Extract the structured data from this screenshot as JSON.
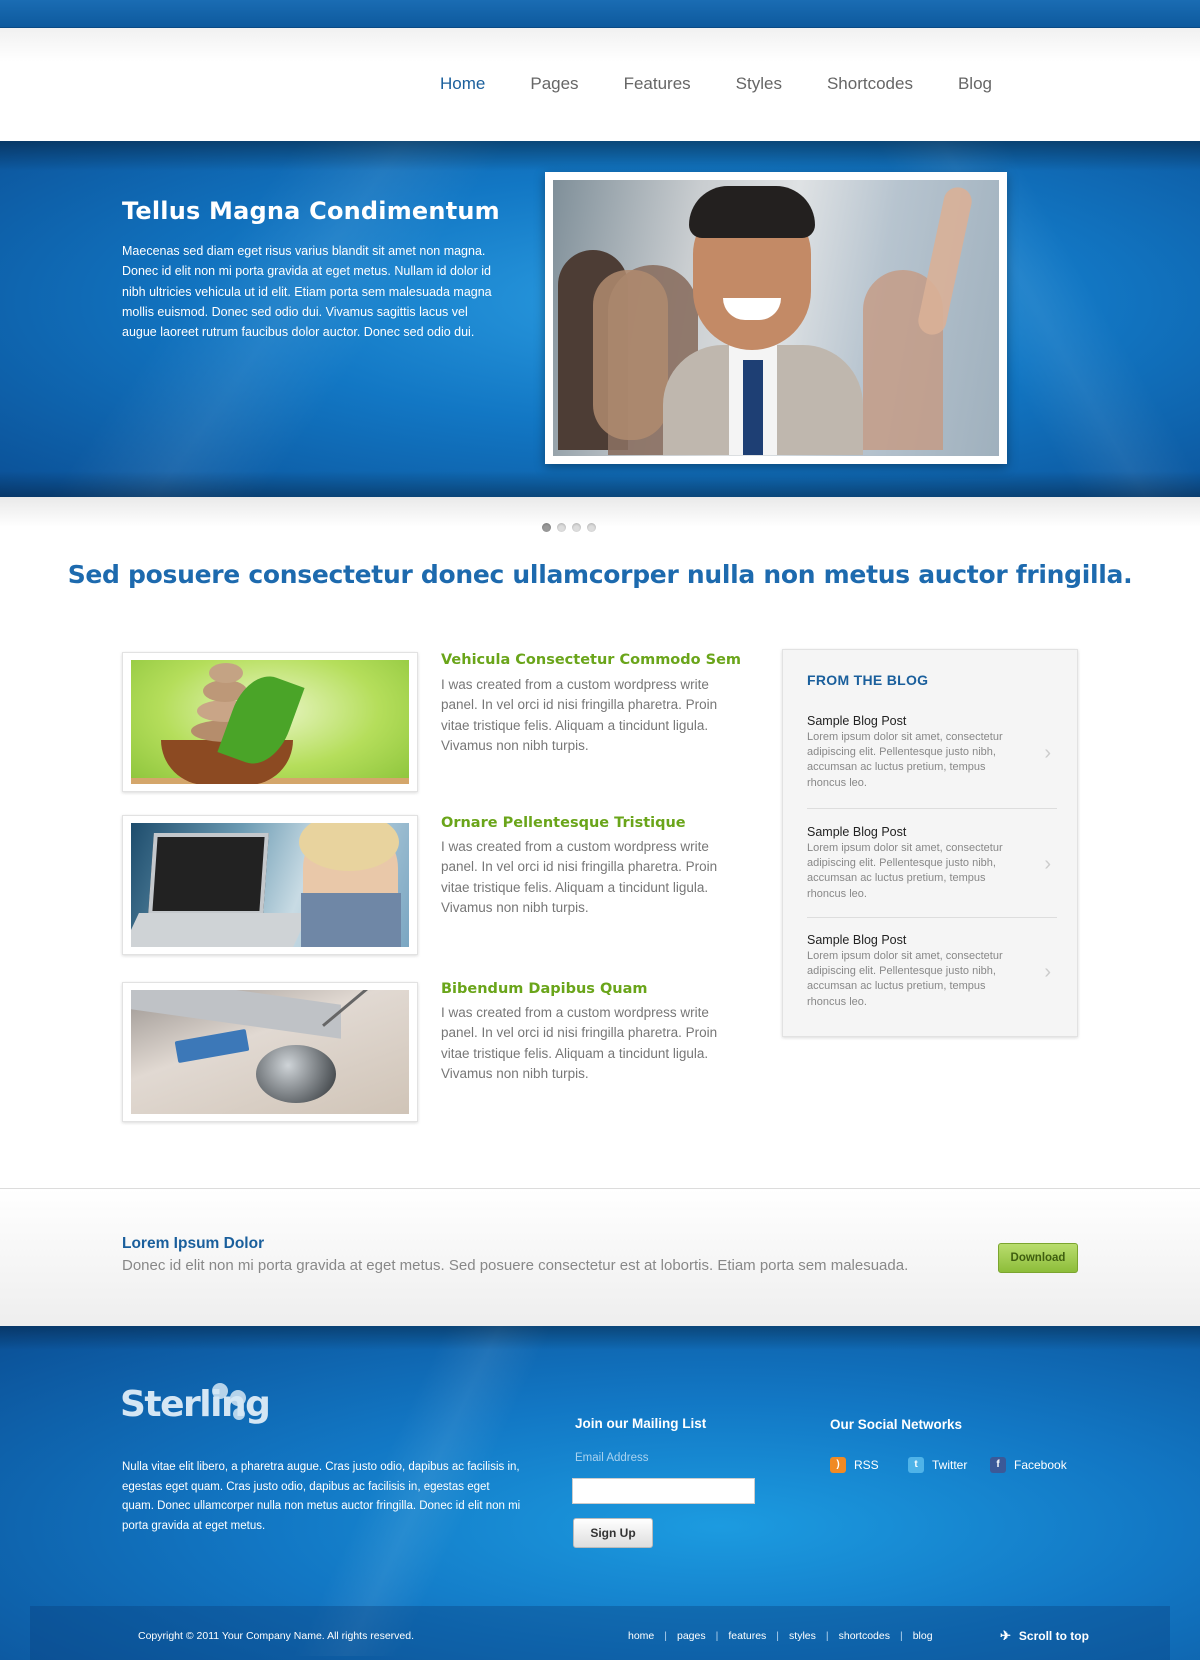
{
  "nav": {
    "items": [
      {
        "label": "Home",
        "active": true
      },
      {
        "label": "Pages",
        "active": false
      },
      {
        "label": "Features",
        "active": false
      },
      {
        "label": "Styles",
        "active": false
      },
      {
        "label": "Shortcodes",
        "active": false
      },
      {
        "label": "Blog",
        "active": false
      }
    ]
  },
  "hero": {
    "title": "Tellus Magna Condimentum",
    "text": "Maecenas sed diam eget risus varius blandit sit amet non magna. Donec id elit non mi porta gravida at eget metus. Nullam id dolor id nibh ultricies vehicula ut id elit. Etiam porta sem malesuada magna mollis euismod. Donec sed odio dui. Vivamus sagittis lacus vel augue laoreet rutrum faucibus dolor auctor. Donec sed odio dui.",
    "slide_count": 4,
    "active_slide": 1
  },
  "tagline": "Sed posuere consectetur donec ullamcorper nulla non metus auctor fringilla.",
  "features": [
    {
      "title": "Vehicula Consectetur Commodo Sem",
      "text": "I was created from a custom wordpress write panel. In vel orci id nisi fringilla pharetra. Proin vitae tristique felis. Aliquam a tincidunt ligula. Vivamus non nibh turpis."
    },
    {
      "title": "Ornare Pellentesque Tristique",
      "text": "I was created from a custom wordpress write panel. In vel orci id nisi fringilla pharetra. Proin vitae tristique felis. Aliquam a tincidunt ligula. Vivamus non nibh turpis."
    },
    {
      "title": "Bibendum Dapibus Quam",
      "text": "I was created from a custom wordpress write panel. In vel orci id nisi fringilla pharetra. Proin vitae tristique felis. Aliquam a tincidunt ligula. Vivamus non nibh turpis."
    }
  ],
  "blog": {
    "heading": "FROM THE BLOG",
    "posts": [
      {
        "title": "Sample Blog Post",
        "excerpt": "Lorem ipsum dolor sit amet, consectetur adipiscing elit. Pellentesque justo nibh, accumsan ac luctus pretium, tempus rhoncus leo."
      },
      {
        "title": "Sample Blog Post",
        "excerpt": "Lorem ipsum dolor sit amet, consectetur adipiscing elit. Pellentesque justo nibh, accumsan ac luctus pretium, tempus rhoncus leo."
      },
      {
        "title": "Sample Blog Post",
        "excerpt": "Lorem ipsum dolor sit amet, consectetur adipiscing elit. Pellentesque justo nibh, accumsan ac luctus pretium, tempus rhoncus leo."
      }
    ],
    "chevron_icon": "chevron-right-icon"
  },
  "callout": {
    "title": "Lorem Ipsum Dolor",
    "text": "Donec id elit non mi porta gravida at eget metus. Sed posuere consectetur est at lobortis. Etiam porta sem malesuada.",
    "button_label": "Download"
  },
  "footer": {
    "logo_text": "Sterling",
    "about": "Nulla vitae elit libero, a pharetra augue. Cras justo odio, dapibus ac facilisis in, egestas eget quam. Cras justo odio, dapibus ac facilisis in, egestas eget quam. Donec ullamcorper nulla non metus auctor fringilla. Donec id elit non mi porta gravida at eget metus.",
    "mailing": {
      "heading": "Join our Mailing List",
      "label": "Email Address",
      "value": "",
      "button_label": "Sign Up"
    },
    "social": {
      "heading": "Our Social Networks",
      "links": [
        {
          "label": "RSS",
          "icon": "rss-icon"
        },
        {
          "label": "Twitter",
          "icon": "twitter-icon"
        },
        {
          "label": "Facebook",
          "icon": "facebook-icon"
        }
      ]
    },
    "copyright": "Copyright © 2011 Your Company Name. All rights reserved.",
    "links": [
      "home",
      "pages",
      "features",
      "styles",
      "shortcodes",
      "blog"
    ],
    "scroll_top_label": "Scroll to top"
  },
  "colors": {
    "brand_blue": "#1a5f9c",
    "accent_green": "#6aa51a",
    "hero_blue": "#1277c4"
  }
}
